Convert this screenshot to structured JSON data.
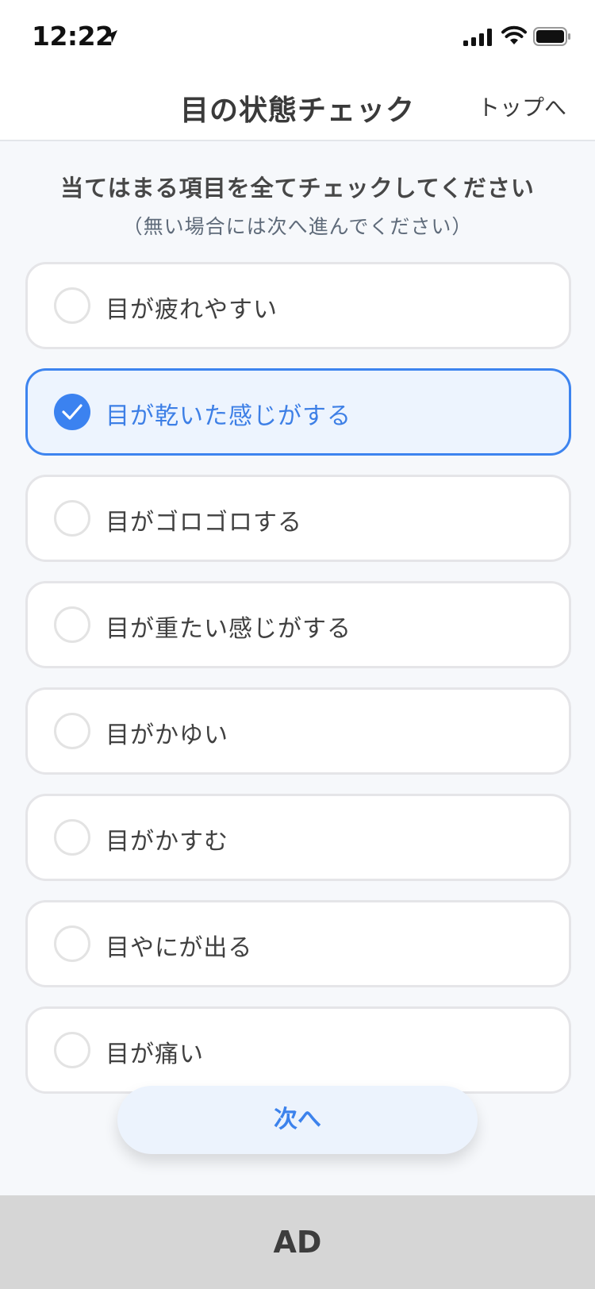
{
  "status_bar": {
    "time": "12:22",
    "icons": [
      "location-arrow-icon",
      "cellular-signal-icon",
      "wifi-icon",
      "battery-icon"
    ]
  },
  "nav": {
    "title": "目の状態チェック",
    "top_link": "トップへ"
  },
  "instructions": {
    "main": "当てはまる項目を全てチェックしてください",
    "sub": "（無い場合には次へ進んでください）"
  },
  "options": [
    {
      "label": "目が疲れやすい",
      "selected": false
    },
    {
      "label": "目が乾いた感じがする",
      "selected": true
    },
    {
      "label": "目がゴロゴロする",
      "selected": false
    },
    {
      "label": "目が重たい感じがする",
      "selected": false
    },
    {
      "label": "目がかゆい",
      "selected": false
    },
    {
      "label": "目がかすむ",
      "selected": false
    },
    {
      "label": "目やにが出る",
      "selected": false
    },
    {
      "label": "目が痛い",
      "selected": false
    }
  ],
  "next_button": "次へ",
  "ad": "AD",
  "colors": {
    "accent": "#3b82f0",
    "selected_bg": "#edf4fe",
    "page_bg": "#f6f8fb",
    "ad_bg": "#d6d6d6"
  }
}
